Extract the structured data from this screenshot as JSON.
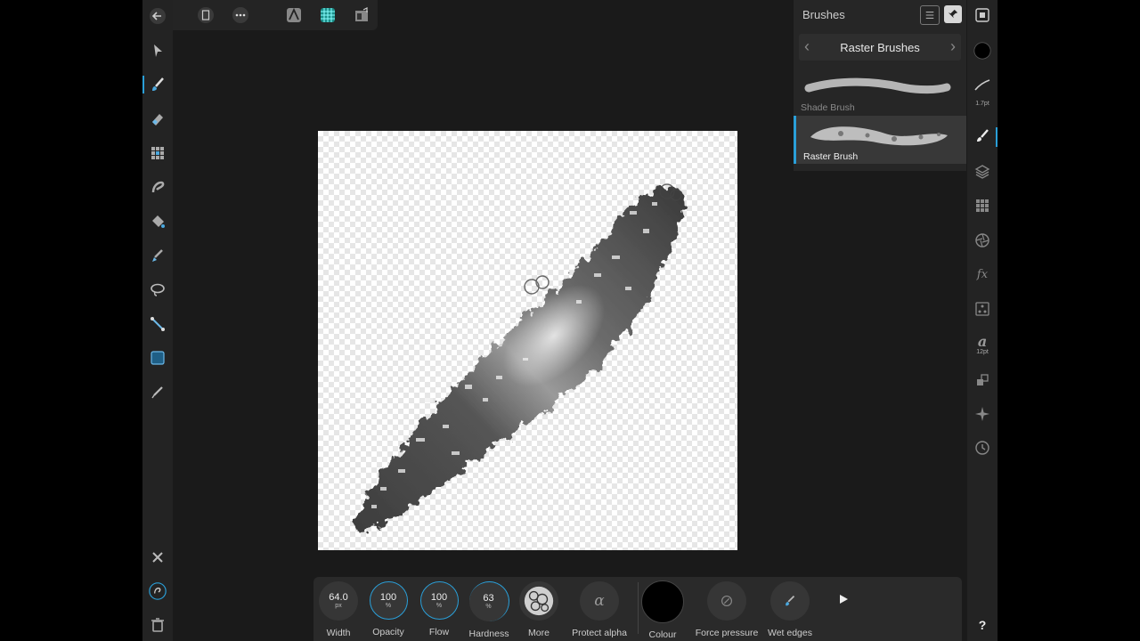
{
  "brushes_panel": {
    "title": "Brushes",
    "category": "Raster Brushes",
    "items": [
      {
        "label": "Shade Brush"
      },
      {
        "label": "Raster Brush"
      }
    ]
  },
  "right_toolbar": {
    "brush_size_label": "1.7pt",
    "text_size_label": "12pt",
    "text_glyph": "a",
    "fx_glyph": "fx",
    "help_glyph": "?"
  },
  "context_toolbar": {
    "width": {
      "value": "64.0",
      "unit": "px",
      "label": "Width"
    },
    "opacity": {
      "value": "100",
      "unit": "%",
      "label": "Opacity"
    },
    "flow": {
      "value": "100",
      "unit": "%",
      "label": "Flow"
    },
    "hardness": {
      "value": "63",
      "unit": "%",
      "label": "Hardness"
    },
    "more": {
      "label": "More"
    },
    "protect_alpha": {
      "label": "Protect alpha",
      "glyph": "α"
    },
    "colour": {
      "label": "Colour",
      "value": "#000000"
    },
    "force_pressure": {
      "label": "Force pressure"
    },
    "wet_edges": {
      "label": "Wet edges"
    }
  },
  "colors": {
    "accent": "#2a9fd8",
    "background": "#1a1a1a",
    "panel": "#262626"
  }
}
